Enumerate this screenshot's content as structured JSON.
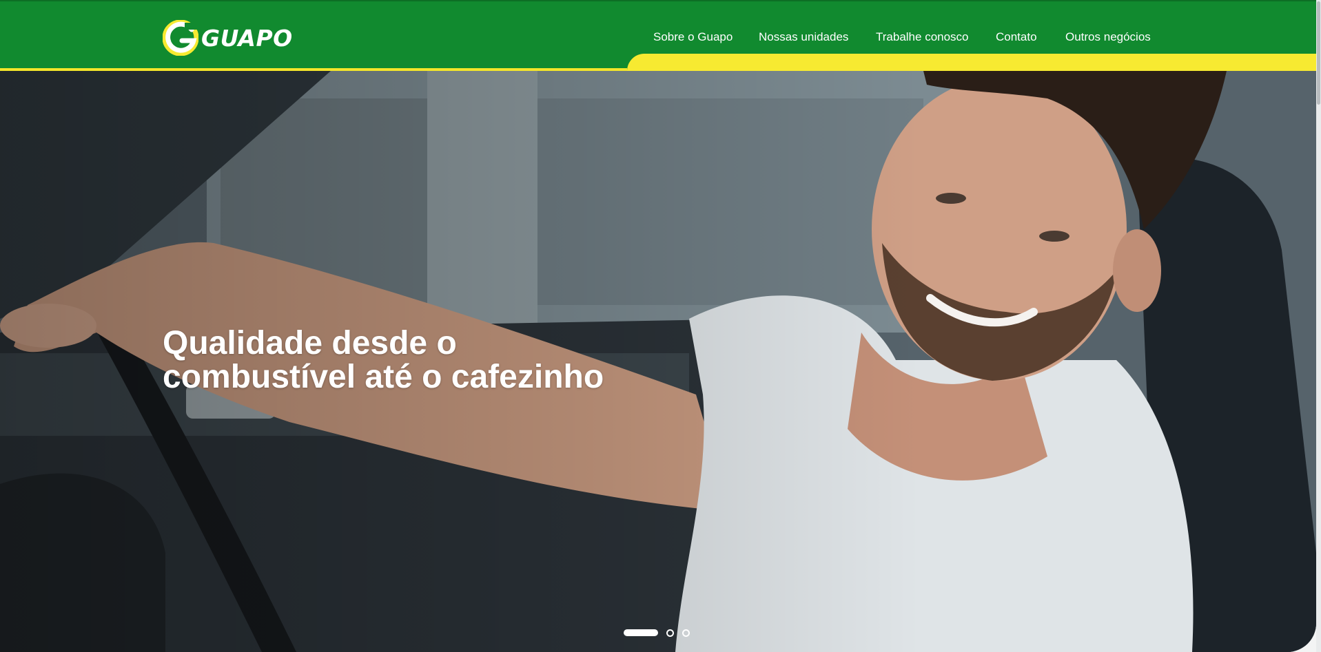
{
  "brand": {
    "logo_text": "GUAPO",
    "colors": {
      "green": "#118a2f",
      "yellow": "#f7ea31",
      "white": "#ffffff"
    }
  },
  "nav": {
    "items": [
      {
        "label": "Sobre o Guapo"
      },
      {
        "label": "Nossas unidades"
      },
      {
        "label": "Trabalhe conosco"
      },
      {
        "label": "Contato"
      },
      {
        "label": "Outros negócios"
      }
    ]
  },
  "hero": {
    "headline_bold": "Qualidade",
    "headline_rest_1": " desde o",
    "headline_line_2": "combustível até o cafezinho",
    "image_icon": "smiling-driver-photo",
    "carousel": {
      "total": 3,
      "active": 1
    }
  }
}
